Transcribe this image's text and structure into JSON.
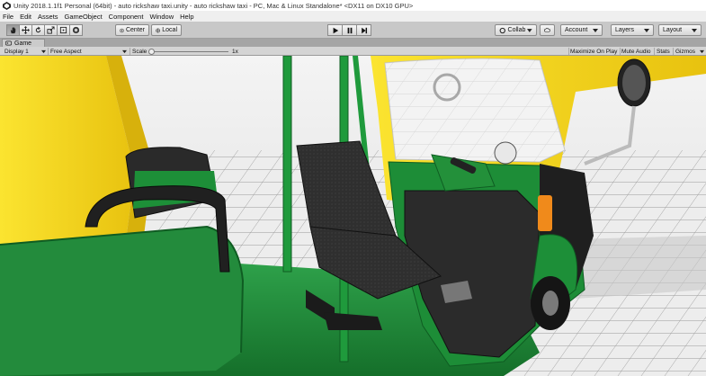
{
  "window": {
    "title": "Unity 2018.1.1f1 Personal (64bit) - auto rickshaw taxi.unity - auto rickshaw taxi - PC, Mac & Linux Standalone* <DX11 on DX10 GPU>"
  },
  "menu": [
    "File",
    "Edit",
    "Assets",
    "GameObject",
    "Component",
    "Window",
    "Help"
  ],
  "toolbar": {
    "transform_tools": [
      "hand-tool",
      "move-tool",
      "rotate-tool",
      "scale-tool",
      "rect-tool",
      "transform-tool"
    ],
    "pivot_label": "Center",
    "space_label": "Local",
    "collab_label": "Collab",
    "account_label": "Account",
    "layers_label": "Layers",
    "layout_label": "Layout"
  },
  "game_panel": {
    "tab_label": "Game",
    "display": "Display 1",
    "aspect": "Free Aspect",
    "scale_label": "Scale",
    "scale_value": "1x",
    "maximize_on_play": "Maximize On Play",
    "mute_audio": "Mute Audio",
    "stats": "Stats",
    "gizmos": "Gizmos"
  },
  "colors": {
    "rickshaw_yellow": "#f7d51d",
    "rickshaw_green": "#1f8e3a",
    "seat_dark": "#2f2f2f"
  }
}
